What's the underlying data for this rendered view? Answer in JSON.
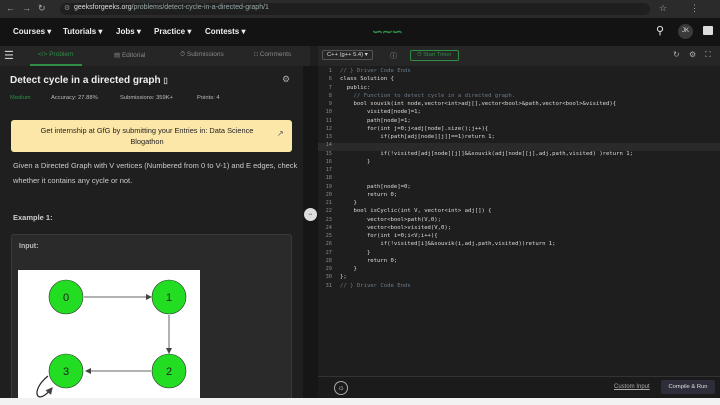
{
  "browser": {
    "url_domain": "geeksforgeeks.org",
    "url_path": "/problems/detect-cycle-in-a-directed-graph/1"
  },
  "header": {
    "menus": [
      "Courses",
      "Tutorials",
      "Jobs",
      "Practice",
      "Contests"
    ],
    "logo": "GfG",
    "avatar_text": "JK"
  },
  "tabs": {
    "problem": "Problem",
    "editorial": "Editorial",
    "submissions": "Submissions",
    "comments": "Comments"
  },
  "controls": {
    "language": "C++ (g++ 5.4)",
    "timer": "Start Timer"
  },
  "problem": {
    "title": "Detect cycle in a directed graph",
    "difficulty": "Medium",
    "accuracy": "Accuracy: 27.88%",
    "submissions": "Submissions: 359K+",
    "points": "Points: 4",
    "banner": "Get internship at GfG by submitting your Entries in: Data Science Blogathon",
    "description_1": "Given a Directed Graph with V vertices (Numbered from 0 to V-1) and E edges, check whether it contains any cycle or not.",
    "example_title": "Example 1:",
    "input_label": "Input:",
    "nodes": [
      "0",
      "1",
      "2",
      "3"
    ]
  },
  "editor": {
    "lines": [
      {
        "n": "1",
        "t": "// } Driver Code Ends"
      },
      {
        "n": "6",
        "t": "class Solution {"
      },
      {
        "n": "7",
        "t": "  public:"
      },
      {
        "n": "8",
        "t": "    // Function to detect cycle in a directed graph."
      },
      {
        "n": "9",
        "t": "    bool souvik(int node,vector<int>adj[],vector<bool>&path,vector<bool>&visited){"
      },
      {
        "n": "10",
        "t": "        visited[node]=1;"
      },
      {
        "n": "11",
        "t": "        path[node]=1;"
      },
      {
        "n": "12",
        "t": "        for(int j=0;j<adj[node].size();j++){"
      },
      {
        "n": "13",
        "t": "            if(path[adj[node][j]]==1)return 1;"
      },
      {
        "n": "14",
        "t": ""
      },
      {
        "n": "15",
        "t": "            if(!visited[adj[node][j]]&&souvik(adj[node][j],adj,path,visited) )return 1;"
      },
      {
        "n": "16",
        "t": "        }"
      },
      {
        "n": "17",
        "t": ""
      },
      {
        "n": "18",
        "t": ""
      },
      {
        "n": "19",
        "t": "        path[node]=0;"
      },
      {
        "n": "20",
        "t": "        return 0;"
      },
      {
        "n": "21",
        "t": "    }"
      },
      {
        "n": "22",
        "t": "    bool isCyclic(int V, vector<int> adj[]) {"
      },
      {
        "n": "23",
        "t": "        vector<bool>path(V,0);"
      },
      {
        "n": "24",
        "t": "        vector<bool>visited(V,0);"
      },
      {
        "n": "25",
        "t": "        for(int i=0;i<V;i++){"
      },
      {
        "n": "26",
        "t": "            if(!visited[i]&&souvik(i,adj,path,visited))return 1;"
      },
      {
        "n": "27",
        "t": "        }"
      },
      {
        "n": "28",
        "t": "        return 0;"
      },
      {
        "n": "29",
        "t": "    }"
      },
      {
        "n": "30",
        "t": "};"
      },
      {
        "n": "31",
        "t": "// } Driver Code Ends"
      }
    ],
    "custom_input": "Custom Input",
    "compile_run": "Compile & Run"
  },
  "colors": {
    "accent": "#2f8d46",
    "banner": "#fde7a8",
    "node": "#22dd22"
  }
}
